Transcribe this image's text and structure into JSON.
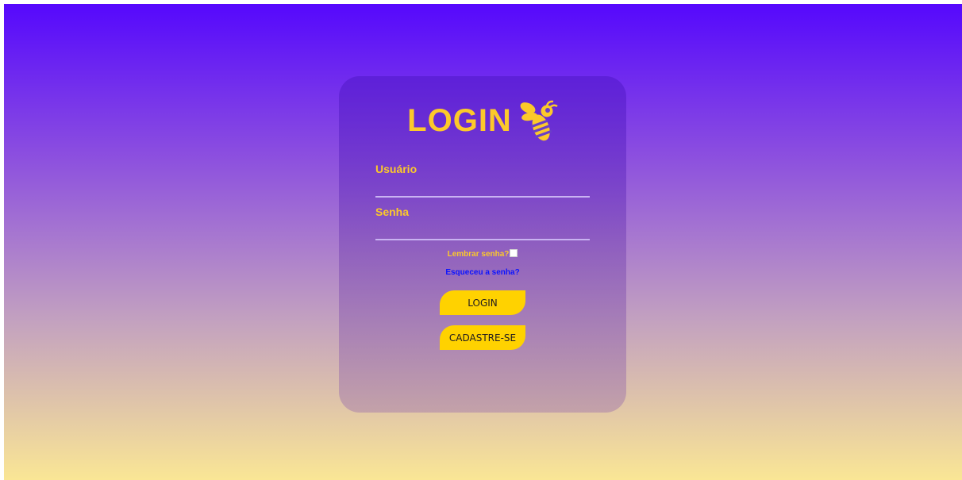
{
  "login": {
    "title": "LOGIN",
    "logo_icon": "bee-icon",
    "username_label": "Usuário",
    "username_value": "",
    "password_label": "Senha",
    "password_value": "",
    "remember_label": "Lembrar senha?",
    "forgot_link": "Esqueceu a senha?",
    "login_button": "LOGIN",
    "signup_button": "CADASTRE-SE"
  },
  "colors": {
    "accent": "#fcc92a",
    "button": "#ffd200",
    "link": "#0b14ff",
    "gradient_top": "#5508fd",
    "gradient_bottom": "#fae695"
  }
}
